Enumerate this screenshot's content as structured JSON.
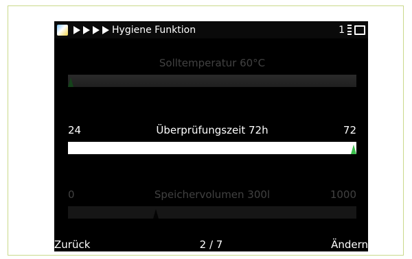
{
  "titlebar": {
    "title": "Hygiene Funktion",
    "page_indicator": "1",
    "icons": [
      "app-icon",
      "nav-arrow-icon",
      "signal-icon",
      "window-icon"
    ]
  },
  "rows": [
    {
      "name": "Solltemperatur",
      "min": "",
      "max": "",
      "label": "Solltemperatur 60°C",
      "state": "faded",
      "marker_fraction": 0.0
    },
    {
      "name": "Überprüfungszeit",
      "min": "24",
      "max": "72",
      "label": "Überprüfungszeit 72h",
      "state": "selected",
      "marker_fraction": 1.0
    },
    {
      "name": "Speichervolumen",
      "min": "0",
      "max": "1000",
      "label": "Speichervolumen 300l",
      "state": "faded",
      "marker_fraction": 0.3
    }
  ],
  "footer": {
    "back_label": "Zurück",
    "page_label": "2 / 7",
    "change_label": "Ändern"
  },
  "colors": {
    "screen_background": "#000000",
    "frame_border": "#c9d98a",
    "marker": "#3bbd4c"
  }
}
